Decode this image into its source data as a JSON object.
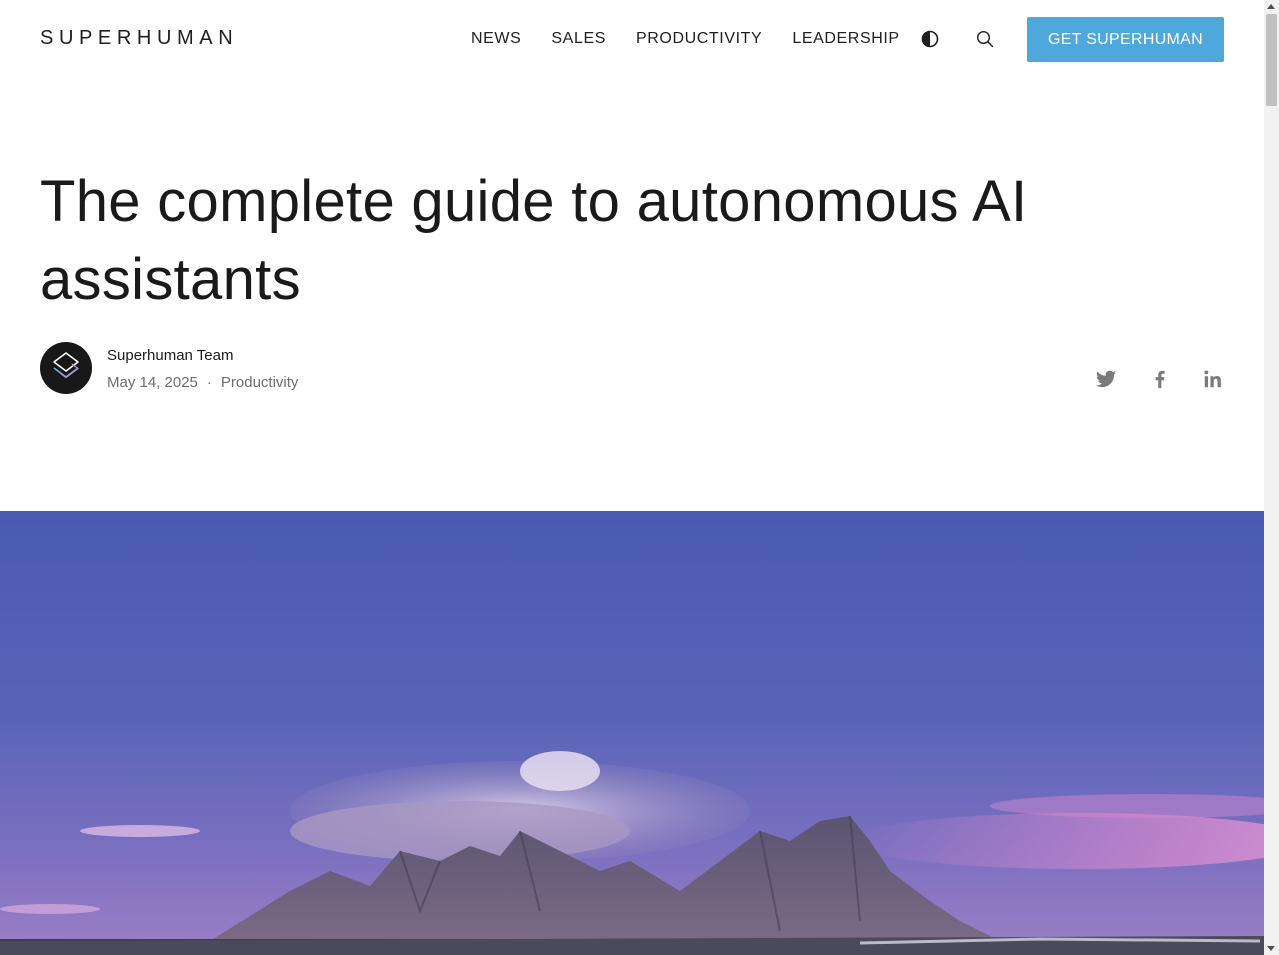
{
  "header": {
    "logo": "SUPERHUMAN",
    "nav": [
      "NEWS",
      "SALES",
      "PRODUCTIVITY",
      "LEADERSHIP"
    ],
    "theme_icon": "contrast-icon",
    "search_icon": "search-icon",
    "cta_label": "GET SUPERHUMAN"
  },
  "article": {
    "title": "The complete guide to autonomous AI assistants",
    "author": "Superhuman Team",
    "date": "May 14, 2025",
    "separator": "·",
    "category": "Productivity",
    "share_icons": [
      "twitter-icon",
      "facebook-icon",
      "linkedin-icon"
    ]
  },
  "hero": {
    "description_icon": "mountain-landscape-image"
  },
  "colors": {
    "accent": "#4ea8dc",
    "text": "#1a1a1a",
    "muted": "#6d6d6d",
    "icon": "#7a7a7a"
  }
}
